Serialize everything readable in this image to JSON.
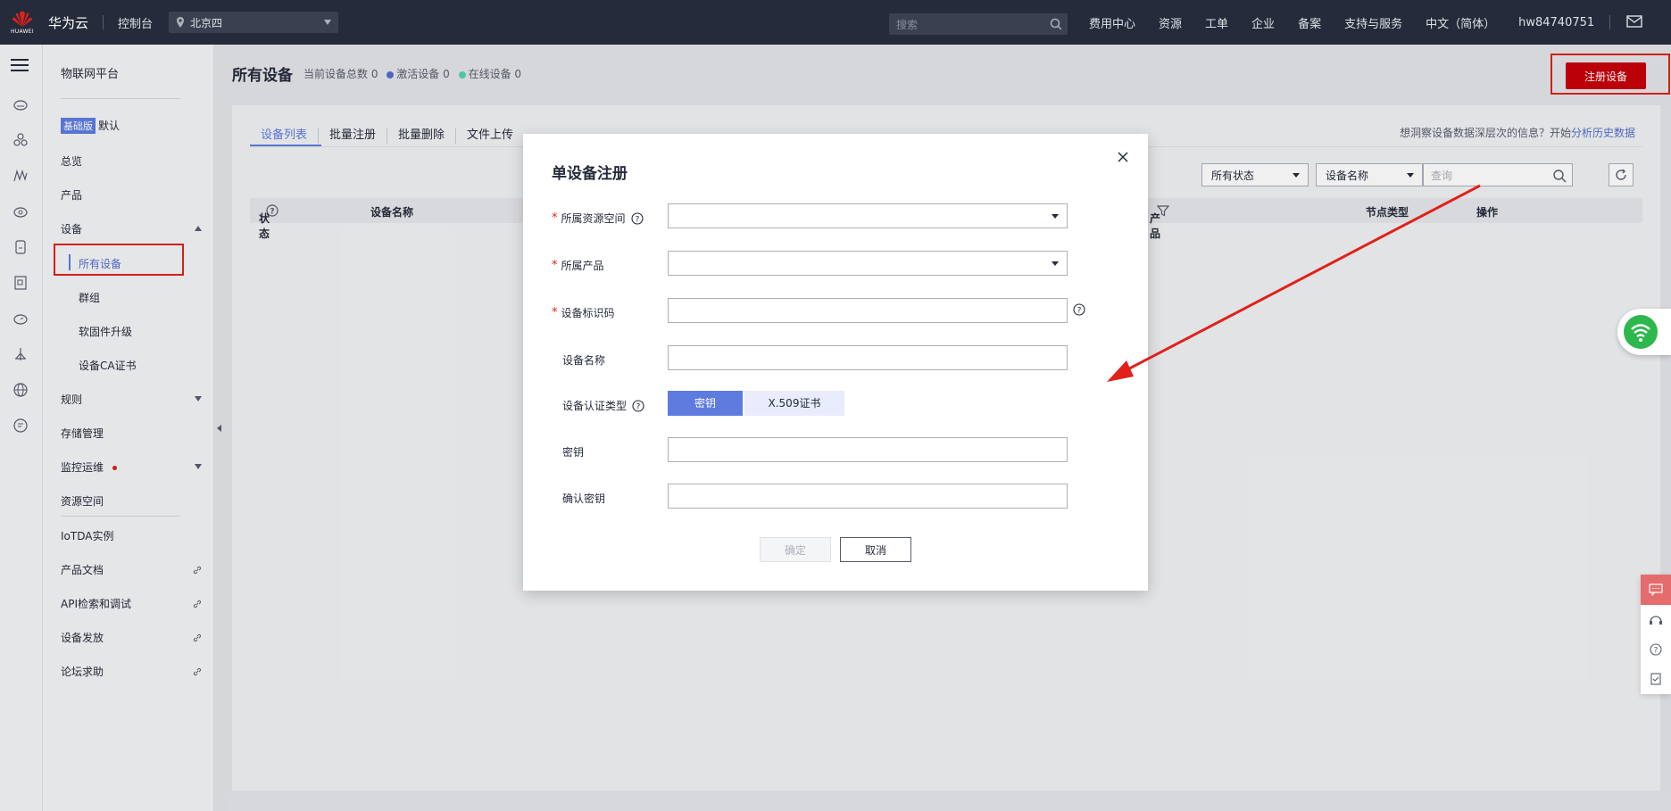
{
  "header": {
    "brand": "华为云",
    "logo_text": "HUAWEI",
    "console": "控制台",
    "region": "北京四",
    "search_placeholder": "搜索",
    "links": [
      "费用中心",
      "资源",
      "工单",
      "企业",
      "备案",
      "支持与服务",
      "中文（简体）",
      "hw84740751"
    ]
  },
  "sidebar": {
    "title": "物联网平台",
    "edition_badge": "基础版",
    "edition_value": "默认",
    "items": {
      "overview": "总览",
      "product": "产品",
      "device": "设备",
      "all_devices": "所有设备",
      "groups": "群组",
      "firmware": "软固件升级",
      "ca_cert": "设备CA证书",
      "rules": "规则",
      "storage": "存储管理",
      "monitor": "监控运维",
      "resource_space": "资源空间",
      "iotda": "IoTDA实例",
      "docs": "产品文档",
      "api": "API检索和调试",
      "provision": "设备发放",
      "forum": "论坛求助"
    }
  },
  "page": {
    "title": "所有设备",
    "total_label": "当前设备总数 0",
    "active_label": "激活设备 0",
    "online_label": "在线设备 0",
    "register_button": "注册设备",
    "tabs": [
      "设备列表",
      "批量注册",
      "批量删除",
      "文件上传"
    ],
    "hint_text": "想洞察设备数据深层次的信息？开始",
    "hint_link": "分析历史数据",
    "filter_status": "所有状态",
    "filter_field": "设备名称",
    "query_placeholder": "查询",
    "columns": {
      "status": "状态",
      "name": "设备名称",
      "product": "产品",
      "node_type": "节点类型",
      "actions": "操作"
    }
  },
  "dialog": {
    "title": "单设备注册",
    "fields": {
      "resource_space": "所属资源空间",
      "product": "所属产品",
      "device_id": "设备标识码",
      "device_name": "设备名称",
      "auth_type": "设备认证类型",
      "secret": "密钥",
      "confirm_secret": "确认密钥"
    },
    "auth_options": [
      "密钥",
      "X.509证书"
    ],
    "ok": "确定",
    "cancel": "取消"
  },
  "colors": {
    "accent": "#5e7ce0",
    "brand_red": "#c7000b",
    "highlight_red": "#e0211b",
    "active_dot": "#526ecc",
    "online_dot": "#50d4ab"
  }
}
